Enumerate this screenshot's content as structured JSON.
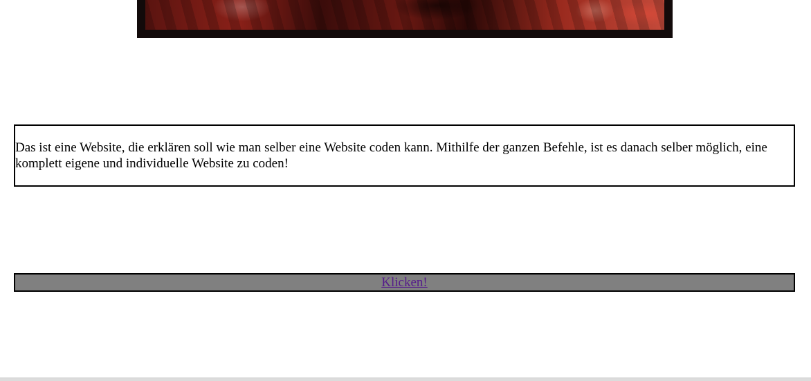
{
  "banner": {
    "image_alt": "Foto einer Menschenmenge in rotem Licht"
  },
  "intro": {
    "text": "Das ist eine Website, die erklären soll wie man selber eine Website coden kann. Mithilfe der ganzen Befehle, ist es danach selber möglich, eine komplett eigene und individuelle Website zu coden!"
  },
  "link": {
    "label": "Klicken!"
  },
  "colors": {
    "link_bar_bg": "#808080",
    "visited_link": "#551a8b",
    "banner_frame": "#120a0a"
  }
}
